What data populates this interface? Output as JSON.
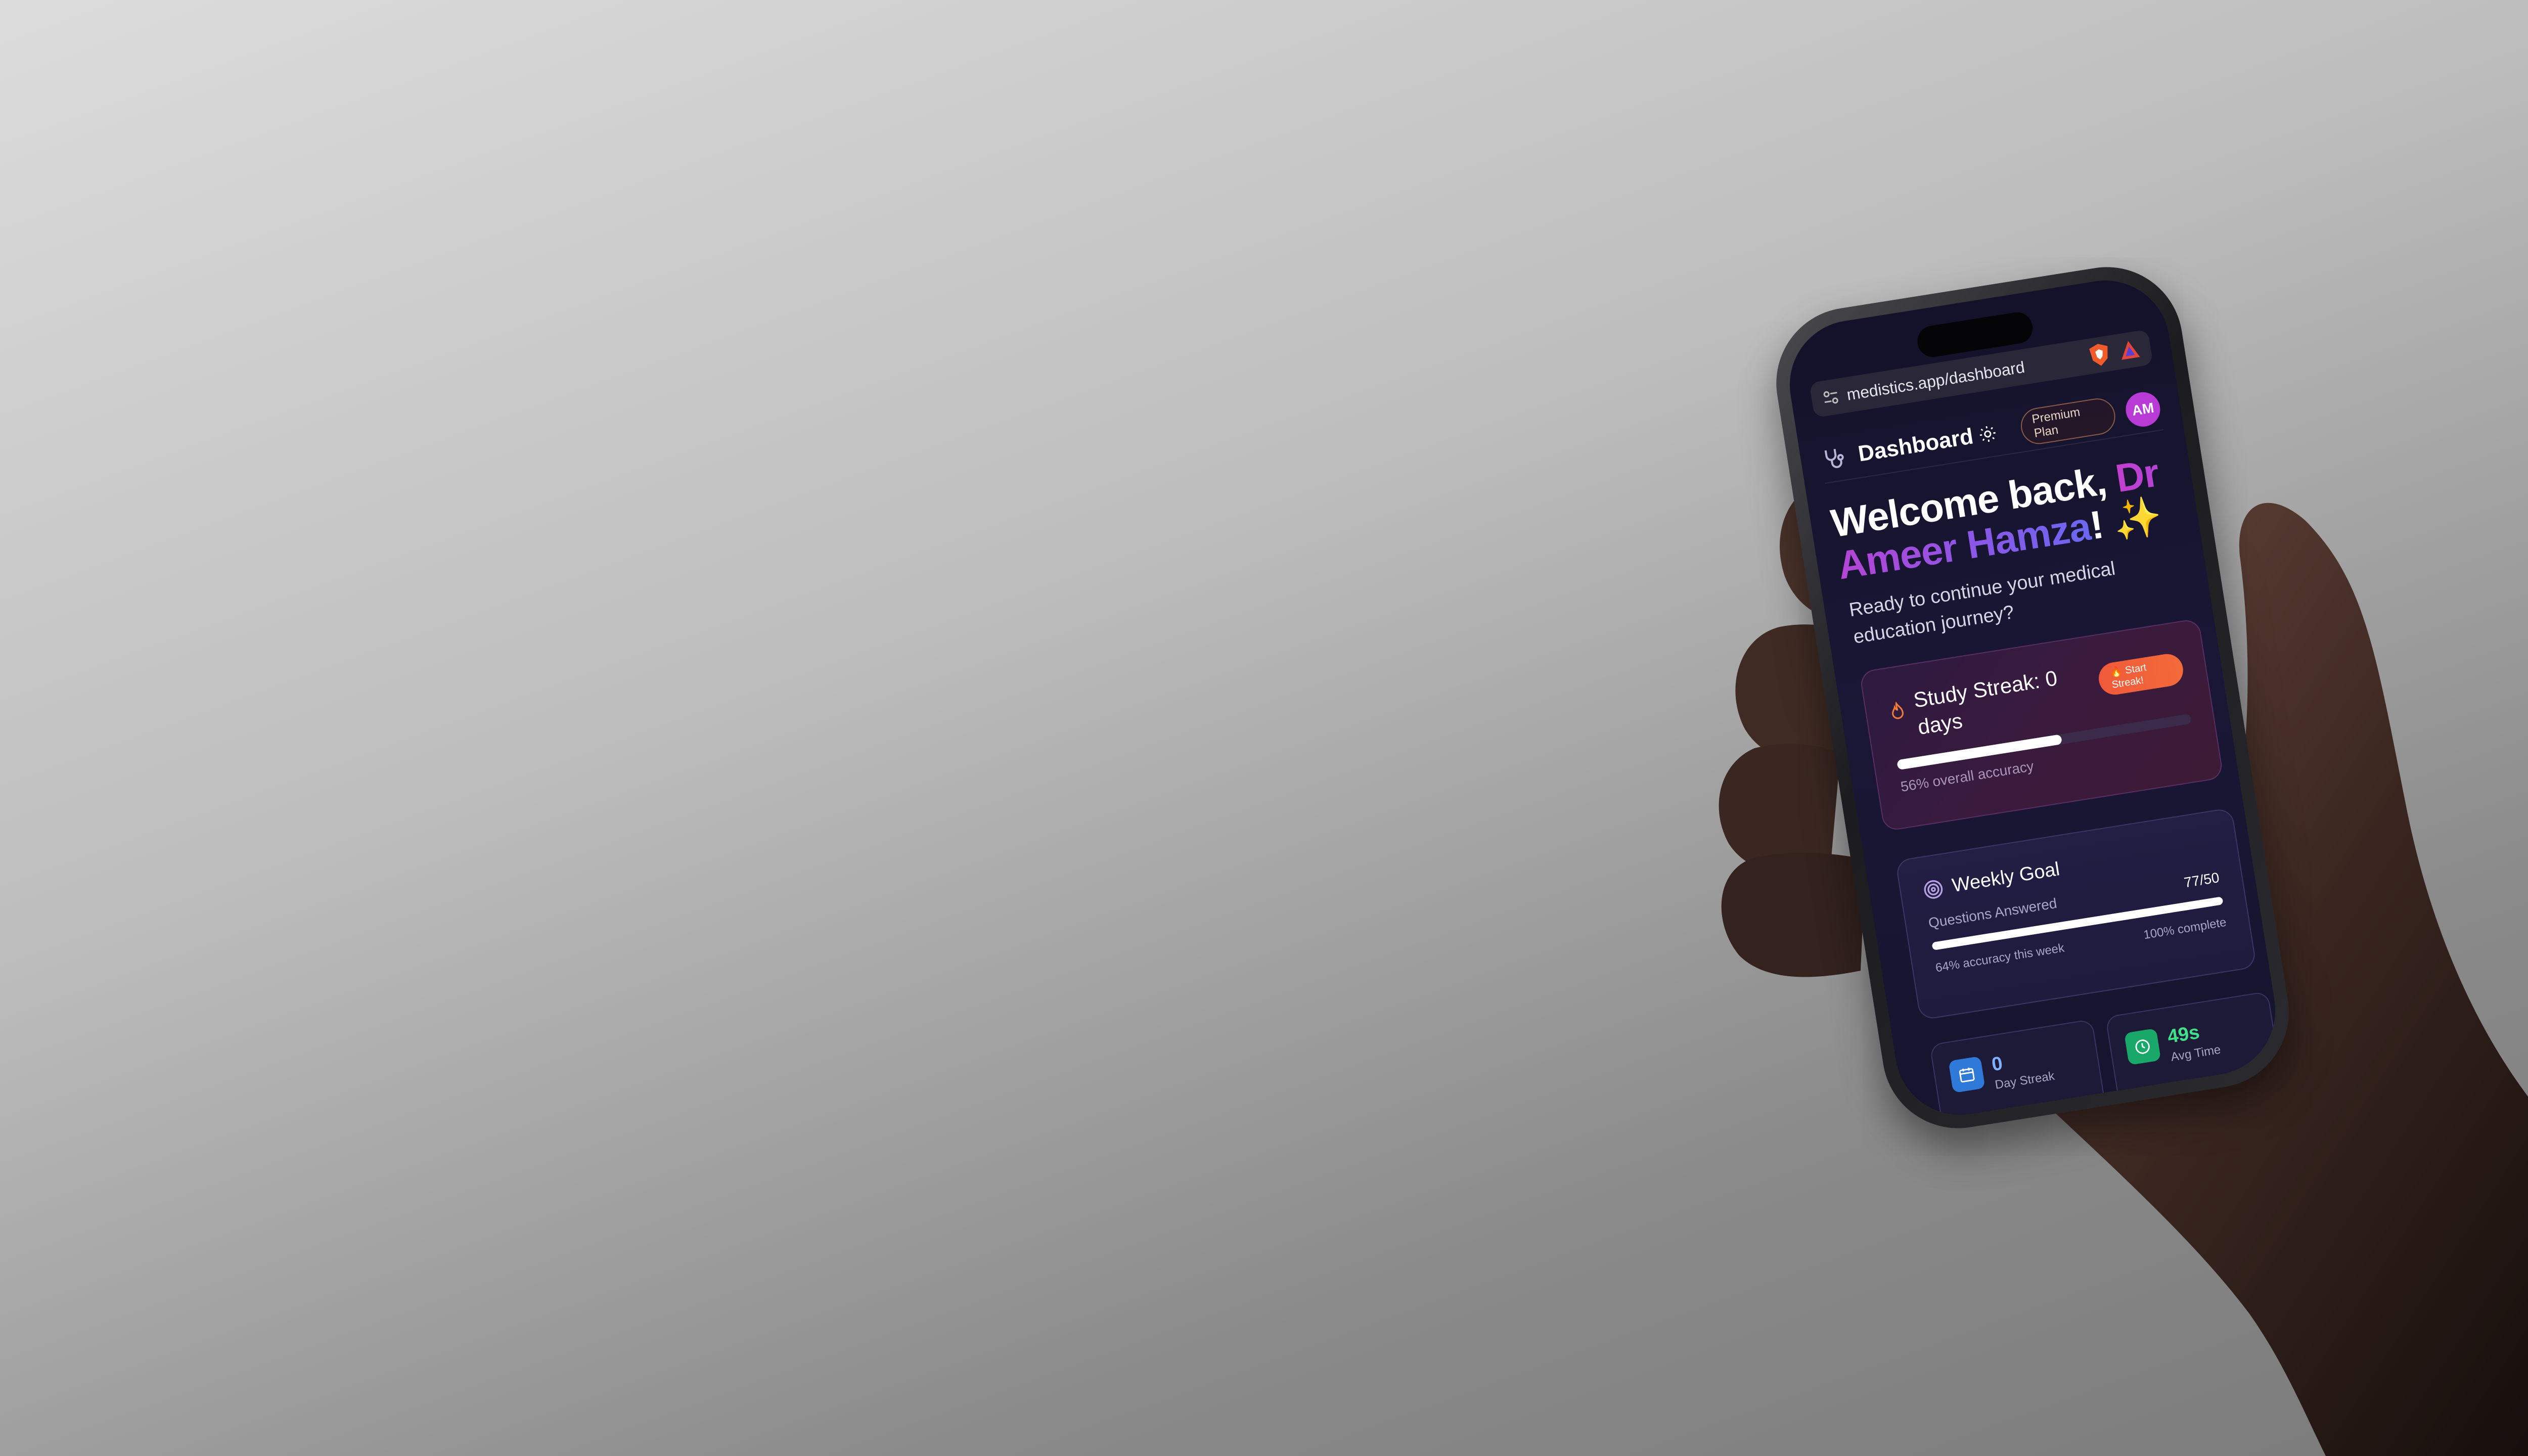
{
  "browser": {
    "url": "medistics.app/dashboard"
  },
  "header": {
    "title": "Dashboard",
    "plan_badge": "Premium Plan",
    "avatar_initials": "AM"
  },
  "welcome": {
    "greeting": "Welcome back, ",
    "name": "Dr Ameer Hamza",
    "suffix": "! ✨",
    "subtitle": "Ready to continue your medical education journey?"
  },
  "streak_card": {
    "title": "Study Streak: 0 days",
    "button_label": "🔥 Start Streak!",
    "progress_percent": 56,
    "note": "56% overall accuracy"
  },
  "weekly_goal": {
    "title": "Weekly Goal",
    "label": "Questions Answered",
    "count": "77/50",
    "progress_percent": 100,
    "accuracy_note": "64% accuracy this week",
    "complete_note": "100% complete"
  },
  "stats": [
    {
      "value": "0",
      "label": "Day Streak",
      "icon": "calendar-icon",
      "color": "#2f7ad9"
    },
    {
      "value": "49s",
      "label": "Avg Time",
      "icon": "clock-icon",
      "color": "#1aa86a"
    }
  ],
  "colors": {
    "accent_purple": "#c23fcf",
    "accent_orange": "#f05a3a",
    "screen_bg": "#14122a"
  }
}
